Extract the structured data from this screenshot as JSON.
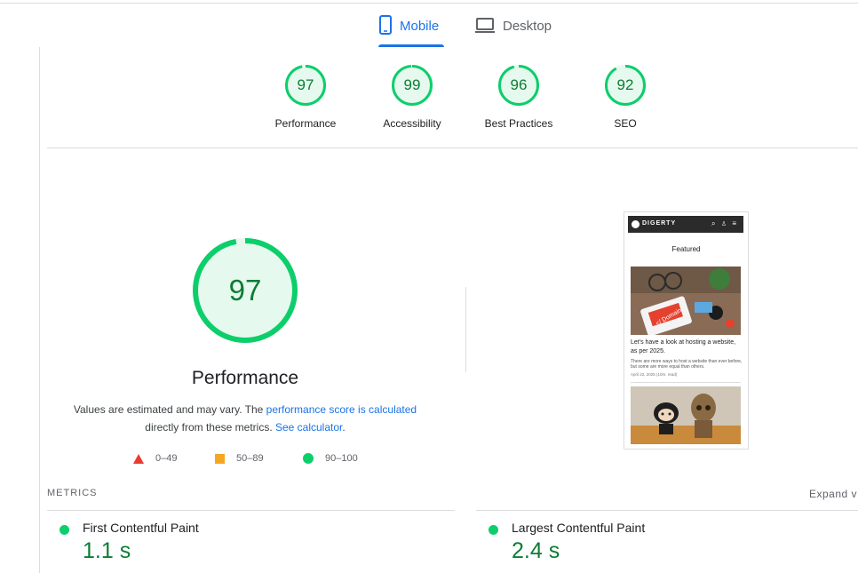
{
  "tabs": [
    {
      "label": "Mobile",
      "icon": "smartphone-icon",
      "active": true
    },
    {
      "label": "Desktop",
      "icon": "laptop-icon",
      "active": false
    }
  ],
  "categories": [
    {
      "score": "97",
      "label": "Performance",
      "fraction": 0.97
    },
    {
      "score": "99",
      "label": "Accessibility",
      "fraction": 0.99
    },
    {
      "score": "96",
      "label": "Best Practices",
      "fraction": 0.96
    },
    {
      "score": "92",
      "label": "SEO",
      "fraction": 0.92
    }
  ],
  "performance": {
    "score": "97",
    "fraction": 0.97,
    "title": "Performance",
    "desc_prefix": "Values are estimated and may vary. The ",
    "desc_link1": "performance score is calculated",
    "desc_middle": "directly from these metrics. ",
    "desc_link2": "See calculator",
    "desc_suffix": "."
  },
  "legend": [
    {
      "shape": "triangle",
      "color": "#eb3a32",
      "label": "0–49"
    },
    {
      "shape": "square",
      "color": "#f5a623",
      "label": "50–89"
    },
    {
      "shape": "circle",
      "color": "#0cce6b",
      "label": "90–100"
    }
  ],
  "metrics": {
    "header": "METRICS",
    "expand": "Expand v",
    "items": [
      {
        "name": "First Contentful Paint",
        "value": "1.1 s"
      },
      {
        "name": "Largest Contentful Paint",
        "value": "2.4 s"
      }
    ]
  },
  "screenshot": {
    "brand": "DIGERTY",
    "featured": "Featured",
    "image_badge": "</ Domain",
    "post_title": "Let's have a look at hosting a website, as per 2025.",
    "excerpt": "There are more ways to host a website than ever before, but some are more equal than others.",
    "date": "April 22, 2025 (10m. read)"
  },
  "colors": {
    "accent": "#1a73e8",
    "pass": "#0cce6b",
    "pass_text": "#0c7c33",
    "pass_bg": "#e6f9ee"
  }
}
